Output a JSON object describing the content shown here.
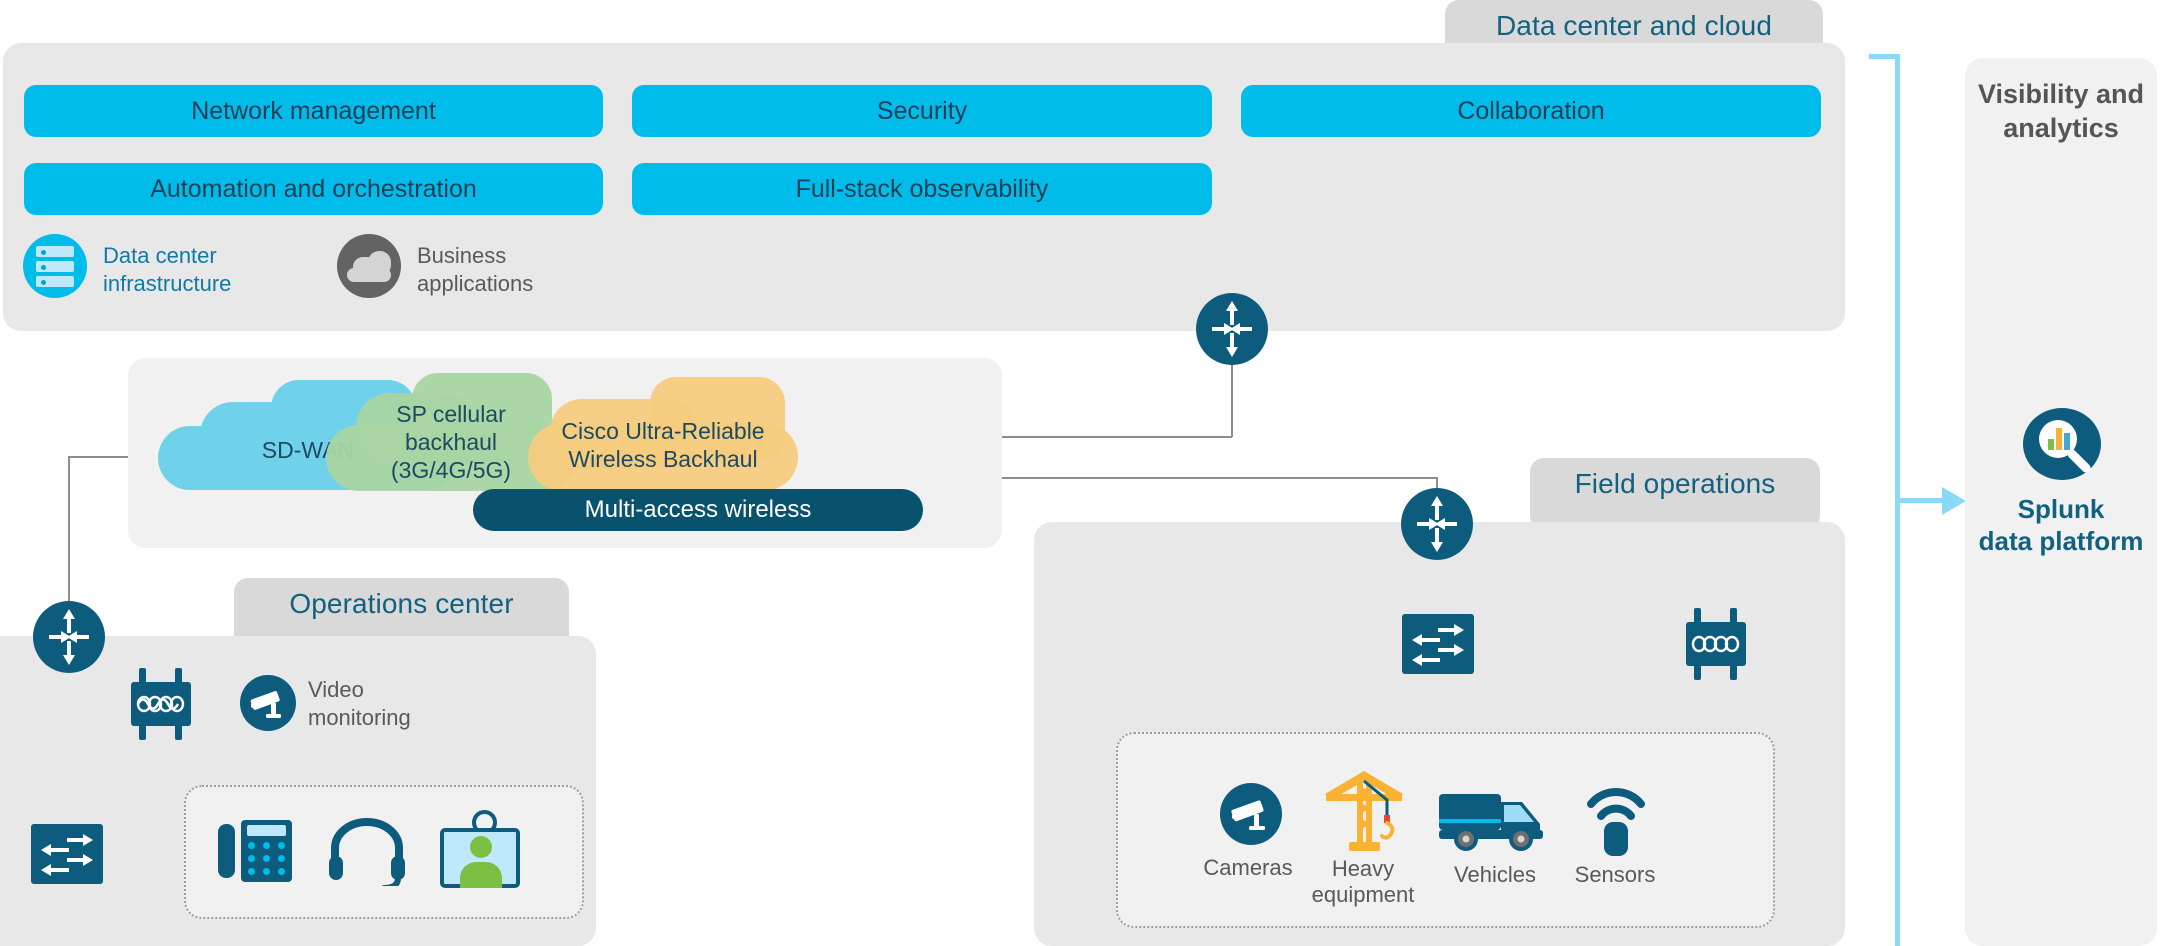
{
  "zones": {
    "datacenter": {
      "label": "Data center and cloud"
    },
    "operations": {
      "label": "Operations center"
    },
    "field": {
      "label": "Field operations"
    },
    "visibility": {
      "label": "Visibility and\nanalytics"
    }
  },
  "datacenter": {
    "pills": [
      {
        "id": "network-management",
        "label": "Network management"
      },
      {
        "id": "security",
        "label": "Security"
      },
      {
        "id": "collaboration",
        "label": "Collaboration"
      },
      {
        "id": "automation-and-orchestration",
        "label": "Automation and orchestration"
      },
      {
        "id": "full-stack-observability",
        "label": "Full-stack observability"
      }
    ],
    "legend": [
      {
        "id": "data-center-infrastructure",
        "line1": "Data center",
        "line2": "infrastructure",
        "icon": "server-stack-icon",
        "color": "#00bceb"
      },
      {
        "id": "business-applications",
        "line1": "Business",
        "line2": "applications",
        "icon": "cloud-icon",
        "color": "#636363"
      }
    ]
  },
  "wireless": {
    "banner": "Multi-access wireless",
    "clouds": [
      {
        "id": "sd-wan",
        "lines": [
          "SD-WAN"
        ],
        "color": "#6fd2ea"
      },
      {
        "id": "sp-cellular-backhaul",
        "lines": [
          "SP cellular",
          "backhaul",
          "(3G/4G/5G)"
        ],
        "color": "#a8d5a2"
      },
      {
        "id": "cisco-ultra-reliable-wireless-backhaul",
        "lines": [
          "Cisco Ultra-Reliable",
          "Wireless Backhaul"
        ],
        "color": "#f6cb7e"
      }
    ]
  },
  "operations": {
    "video_monitoring": {
      "line1": "Video",
      "line2": "monitoring"
    },
    "endpoints": [
      {
        "id": "ip-phone",
        "icon": "desk-phone-icon"
      },
      {
        "id": "headset",
        "icon": "headset-icon"
      },
      {
        "id": "badge",
        "icon": "id-badge-icon"
      }
    ]
  },
  "field": {
    "assets": [
      {
        "id": "cameras",
        "label": "Cameras",
        "icon": "camera-icon"
      },
      {
        "id": "heavy-equipment",
        "label": "Heavy\nequipment",
        "icon": "crane-icon"
      },
      {
        "id": "vehicles",
        "label": "Vehicles",
        "icon": "truck-icon"
      },
      {
        "id": "sensors",
        "label": "Sensors",
        "icon": "sensor-icon"
      }
    ]
  },
  "visibility": {
    "splunk": {
      "line1": "Splunk",
      "line2": "data platform",
      "icon": "splunk-magnifier-icon"
    }
  },
  "colors": {
    "cisco_blue": "#00bceb",
    "deep_blue": "#0d5c7d",
    "panel_gray": "#e8e8e8",
    "tab_gray": "#d9d9d9",
    "line_gray": "#8d8d8d",
    "accent_light_blue": "#8ad9f7"
  }
}
